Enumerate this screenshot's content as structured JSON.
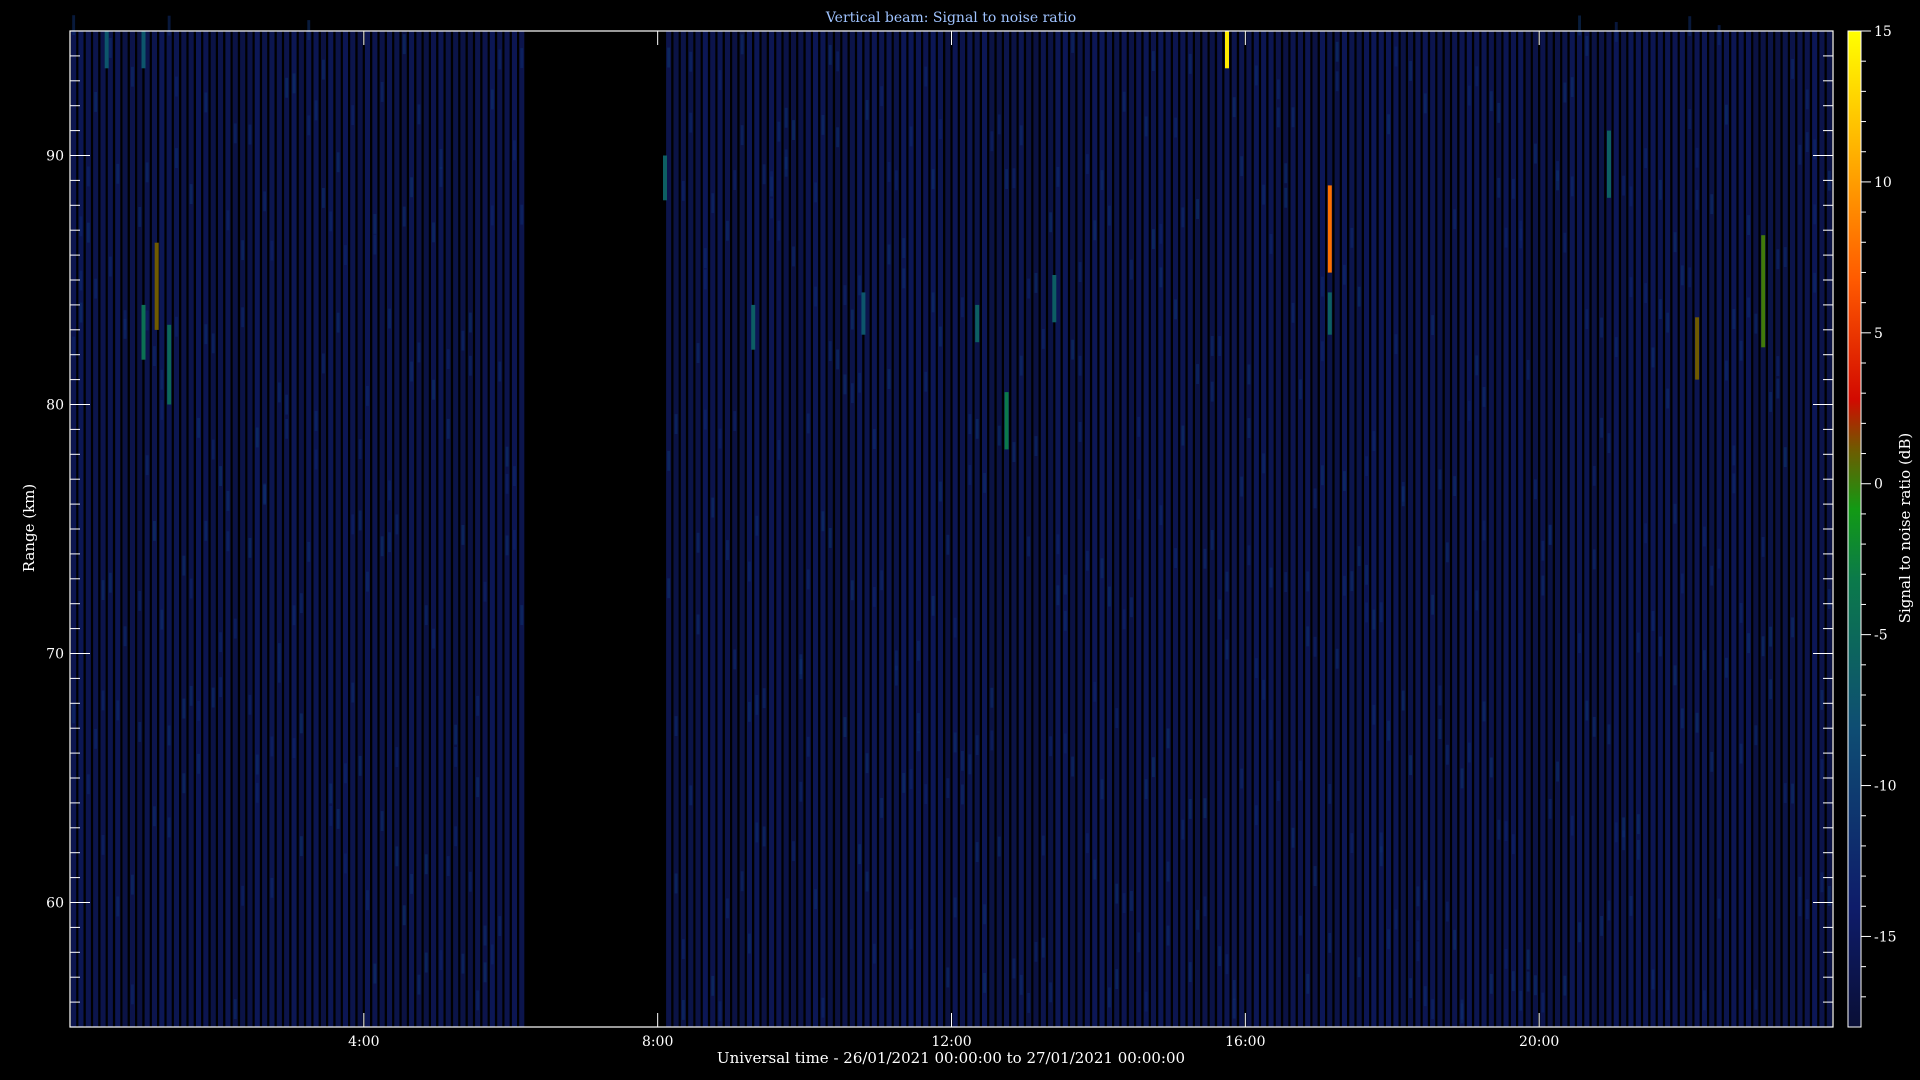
{
  "chart_data": {
    "type": "heatmap",
    "title": "Vertical beam: Signal to noise ratio",
    "xlabel": "Universal time - 26/01/2021 00:00:00 to 27/01/2021 00:00:00",
    "ylabel": "Range (km)",
    "colorbar_label": "Signal to noise ratio (dB)",
    "x_range_hours": [
      0,
      24
    ],
    "y_range_km": [
      55,
      95
    ],
    "color_range_db": [
      -18,
      15
    ],
    "x_ticks": [
      {
        "hour": 4,
        "label": "4:00"
      },
      {
        "hour": 8,
        "label": "8:00"
      },
      {
        "hour": 12,
        "label": "12:00"
      },
      {
        "hour": 16,
        "label": "16:00"
      },
      {
        "hour": 20,
        "label": "20:00"
      }
    ],
    "y_ticks": [
      {
        "km": 60,
        "label": "60"
      },
      {
        "km": 70,
        "label": "70"
      },
      {
        "km": 80,
        "label": "80"
      },
      {
        "km": 90,
        "label": "90"
      }
    ],
    "colorbar_ticks": [
      {
        "db": 15,
        "label": "15"
      },
      {
        "db": 10,
        "label": "10"
      },
      {
        "db": 5,
        "label": "5"
      },
      {
        "db": 0,
        "label": "0"
      },
      {
        "db": -5,
        "label": "-5"
      },
      {
        "db": -10,
        "label": "-10"
      },
      {
        "db": -15,
        "label": "-15"
      }
    ],
    "data_gaps_hours": [
      [
        6.2,
        8.0
      ]
    ],
    "background_level_db": -17,
    "echoes": [
      {
        "hour": 0.5,
        "km_from": 93.5,
        "km_to": 95.0,
        "db": -7
      },
      {
        "hour": 1.0,
        "km_from": 81.8,
        "km_to": 84.0,
        "db": -4
      },
      {
        "hour": 1.0,
        "km_from": 93.5,
        "km_to": 95.0,
        "db": -7
      },
      {
        "hour": 1.18,
        "km_from": 83.0,
        "km_to": 86.5,
        "db": 1
      },
      {
        "hour": 1.35,
        "km_from": 80.0,
        "km_to": 83.2,
        "db": -5
      },
      {
        "hour": 8.1,
        "km_from": 88.2,
        "km_to": 90.0,
        "db": -6
      },
      {
        "hour": 9.3,
        "km_from": 82.2,
        "km_to": 84.0,
        "db": -6
      },
      {
        "hour": 10.8,
        "km_from": 82.8,
        "km_to": 84.5,
        "db": -7
      },
      {
        "hour": 12.35,
        "km_from": 82.5,
        "km_to": 84.0,
        "db": -6
      },
      {
        "hour": 12.75,
        "km_from": 78.2,
        "km_to": 80.5,
        "db": -3
      },
      {
        "hour": 13.4,
        "km_from": 83.3,
        "km_to": 85.2,
        "db": -6
      },
      {
        "hour": 15.75,
        "km_from": 93.5,
        "km_to": 95.0,
        "db": 14
      },
      {
        "hour": 17.15,
        "km_from": 85.3,
        "km_to": 88.8,
        "db": 8
      },
      {
        "hour": 17.15,
        "km_from": 82.8,
        "km_to": 84.5,
        "db": -6
      },
      {
        "hour": 20.95,
        "km_from": 88.3,
        "km_to": 91.0,
        "db": -6
      },
      {
        "hour": 22.15,
        "km_from": 81.0,
        "km_to": 83.5,
        "db": 1
      },
      {
        "hour": 23.05,
        "km_from": 82.3,
        "km_to": 86.8,
        "db": 0
      }
    ]
  }
}
